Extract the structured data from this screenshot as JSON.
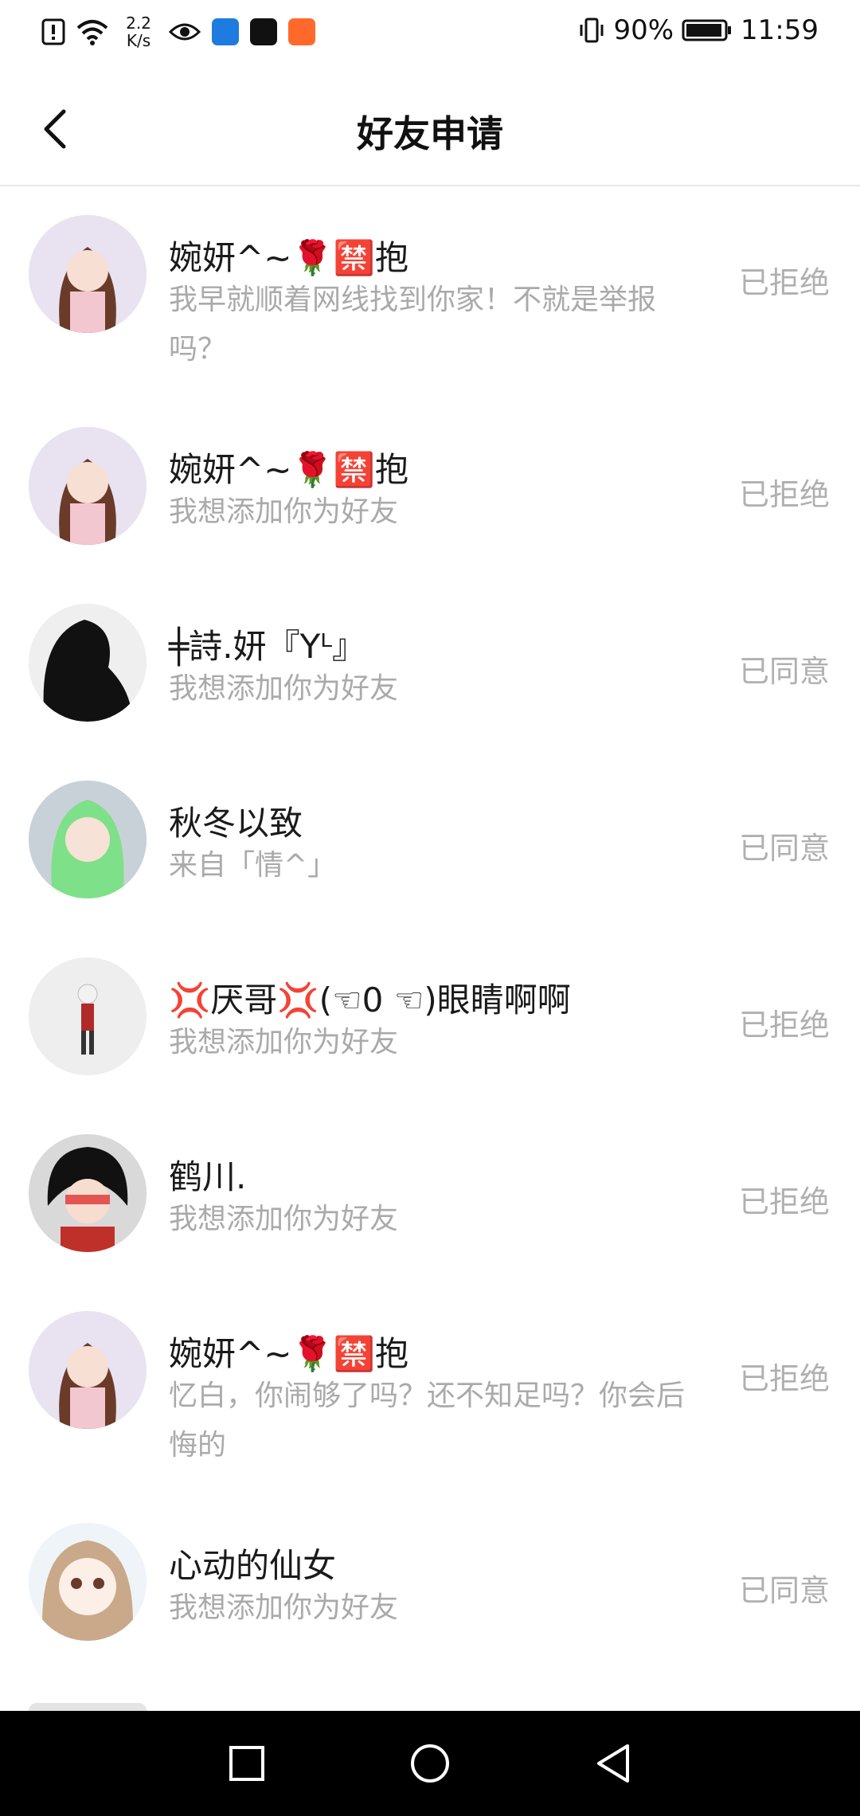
{
  "status_bar": {
    "network_speed": "2.2\nK/s",
    "battery": "90%",
    "time": "11:59",
    "icons": [
      "alert-icon",
      "wifi-icon",
      "eye-icon",
      "shield-app-icon",
      "tiktok-app-icon",
      "orange-app-icon",
      "vibrate-icon",
      "battery-icon"
    ]
  },
  "header": {
    "title": "好友申请",
    "back_icon": "chevron-left-icon"
  },
  "requests": [
    {
      "name": "婉妍^~🌹🈲抱",
      "message": "我早就顺着网线找到你家！不就是举报吗？",
      "status": "已拒绝"
    },
    {
      "name": "婉妍^~🌹🈲抱",
      "message": "我想添加你为好友",
      "status": "已拒绝"
    },
    {
      "name": "╪詩.妍『Yᴸ』",
      "message": "我想添加你为好友",
      "status": "已同意"
    },
    {
      "name": "秋冬以致",
      "message": "来自「情^」",
      "status": "已同意"
    },
    {
      "name": "💢厌哥💢(☜0 ☜)眼睛啊啊",
      "message": "我想添加你为好友",
      "status": "已拒绝"
    },
    {
      "name": "鹤川.",
      "message": "我想添加你为好友",
      "status": "已拒绝"
    },
    {
      "name": "婉妍^~🌹🈲抱",
      "message": "忆白，你闹够了吗？还不知足吗？你会后悔的",
      "status": "已拒绝"
    },
    {
      "name": "心动的仙女",
      "message": "我想添加你为好友",
      "status": "已同意"
    }
  ],
  "nav_bar": {
    "icons": [
      "recent-apps-icon",
      "home-icon",
      "back-icon"
    ]
  }
}
